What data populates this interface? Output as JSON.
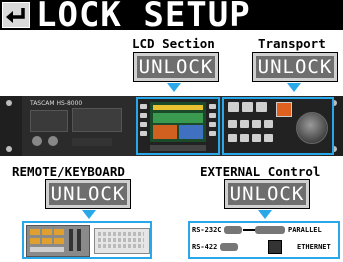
{
  "header": {
    "title": "LOCK SETUP",
    "back_icon": "return-arrow-icon"
  },
  "sections": {
    "lcd": {
      "label": "LCD Section",
      "button": "UNLOCK"
    },
    "transport": {
      "label": "Transport",
      "button": "UNLOCK"
    },
    "remote_keyboard": {
      "label": "REMOTE/KEYBOARD",
      "button": "UNLOCK"
    },
    "external": {
      "label": "EXTERNAL Control",
      "button": "UNLOCK"
    }
  },
  "device": {
    "brand": "TASCAM HS-8000"
  },
  "external_ports": {
    "rs232c": "RS-232C",
    "parallel": "PARALLEL",
    "rs422": "RS-422",
    "ethernet": "ETHERNET"
  },
  "colors": {
    "title_bar": "#000000",
    "button_fill": "#6e6e6e",
    "highlight": "#2aa7e8",
    "background": "#ffffff"
  }
}
